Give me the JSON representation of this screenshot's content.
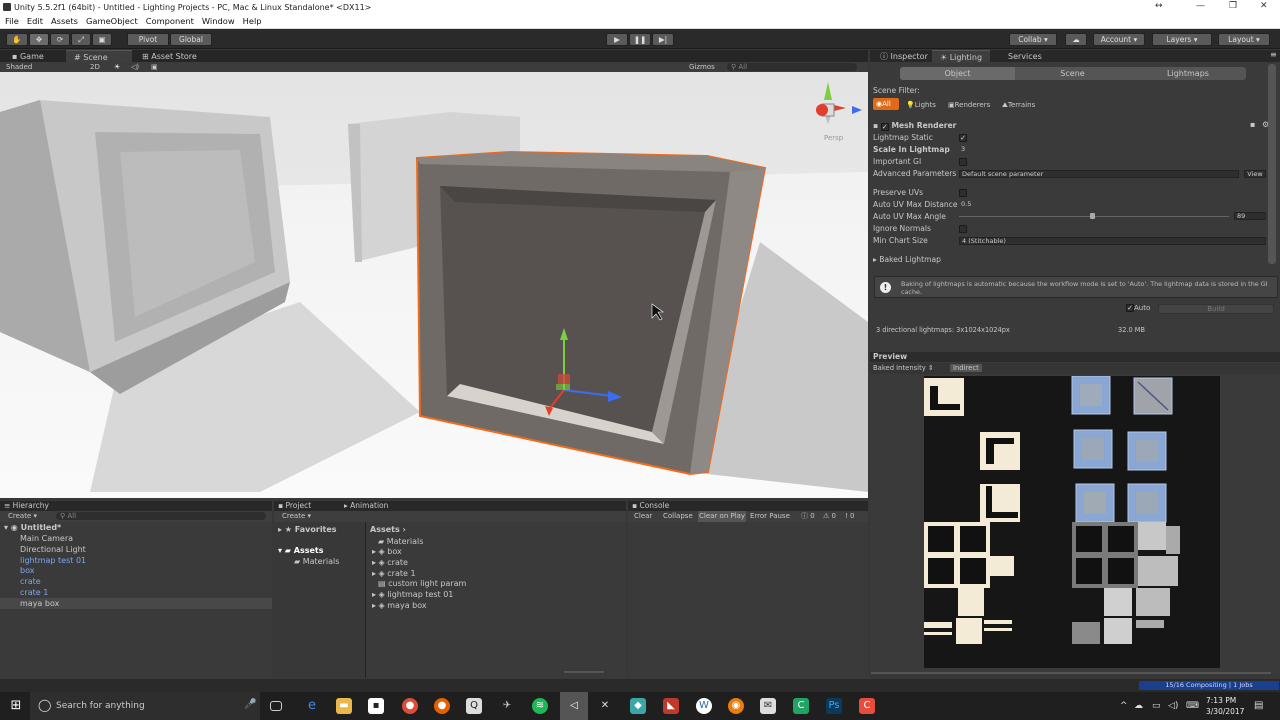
{
  "window": {
    "title": "Unity 5.5.2f1 (64bit) - Untitled - Lighting Projects - PC, Mac & Linux Standalone* <DX11>"
  },
  "menu": [
    "File",
    "Edit",
    "Assets",
    "GameObject",
    "Component",
    "Window",
    "Help"
  ],
  "toolbar": {
    "pivot": "Pivot",
    "global": "Global",
    "collab": "Collab",
    "account": "Account",
    "layers": "Layers",
    "layout": "Layout"
  },
  "scene": {
    "tabs": [
      "Game",
      "Scene",
      "Asset Store"
    ],
    "shaded": "Shaded",
    "mode2d": "2D",
    "gizmos": "Gizmos",
    "search": "All",
    "persp": "Persp"
  },
  "hierarchy": {
    "tab": "Hierarchy",
    "create": "Create",
    "search": "All",
    "scene": "Untitled*",
    "items": [
      "Main Camera",
      "Directional Light",
      "lightmap test 01",
      "box",
      "crate",
      "crate 1",
      "maya box"
    ]
  },
  "project": {
    "tabs": [
      "Project",
      "Animation"
    ],
    "create": "Create",
    "favorites": "Favorites",
    "assets": "Assets",
    "materials": "Materials",
    "breadcrumb": "Assets ›",
    "items": [
      "Materials",
      "box",
      "crate",
      "crate 1",
      "custom light param",
      "lightmap test 01",
      "maya box"
    ]
  },
  "console": {
    "tab": "Console",
    "buttons": [
      "Clear",
      "Collapse",
      "Clear on Play",
      "Error Pause"
    ],
    "counts": [
      "0",
      "0",
      "0"
    ]
  },
  "inspector": {
    "tabs": [
      "Inspector",
      "Lighting",
      "Services"
    ],
    "subtabs": [
      "Object",
      "Scene",
      "Lightmaps"
    ],
    "scene_filter": "Scene Filter:",
    "filters": [
      "All",
      "Lights",
      "Renderers",
      "Terrains"
    ],
    "component": "Mesh Renderer",
    "rows": [
      {
        "label": "Lightmap Static",
        "value": "✓"
      },
      {
        "label": "Scale In Lightmap",
        "value": "3"
      },
      {
        "label": "Important GI",
        "value": ""
      },
      {
        "label": "Advanced Parameters",
        "value": "Default scene parameter"
      },
      {
        "label": "Preserve UVs",
        "value": ""
      },
      {
        "label": "Auto UV Max Distance",
        "value": "0.5"
      },
      {
        "label": "Auto UV Max Angle",
        "value": "89"
      },
      {
        "label": "Ignore Normals",
        "value": ""
      },
      {
        "label": "Min Chart Size",
        "value": "4 (Stitchable)"
      }
    ],
    "view_btn": "View",
    "baked_lightmap": "Baked Lightmap",
    "info": "Baking of lightmaps is automatic because the workflow mode is set to 'Auto'. The lightmap data is stored in the GI cache.",
    "auto": "Auto",
    "build": "Build",
    "stats": "3 directional lightmaps: 3x1024x1024px",
    "size": "32.0 MB",
    "preview": "Preview",
    "baked_intensity": "Baked Intensity",
    "indirect": "Indirect",
    "status": "15/16 Compositing | 1 Jobs"
  },
  "taskbar": {
    "search": "Search for anything",
    "time": "7:13 PM",
    "date": "3/30/2017"
  }
}
